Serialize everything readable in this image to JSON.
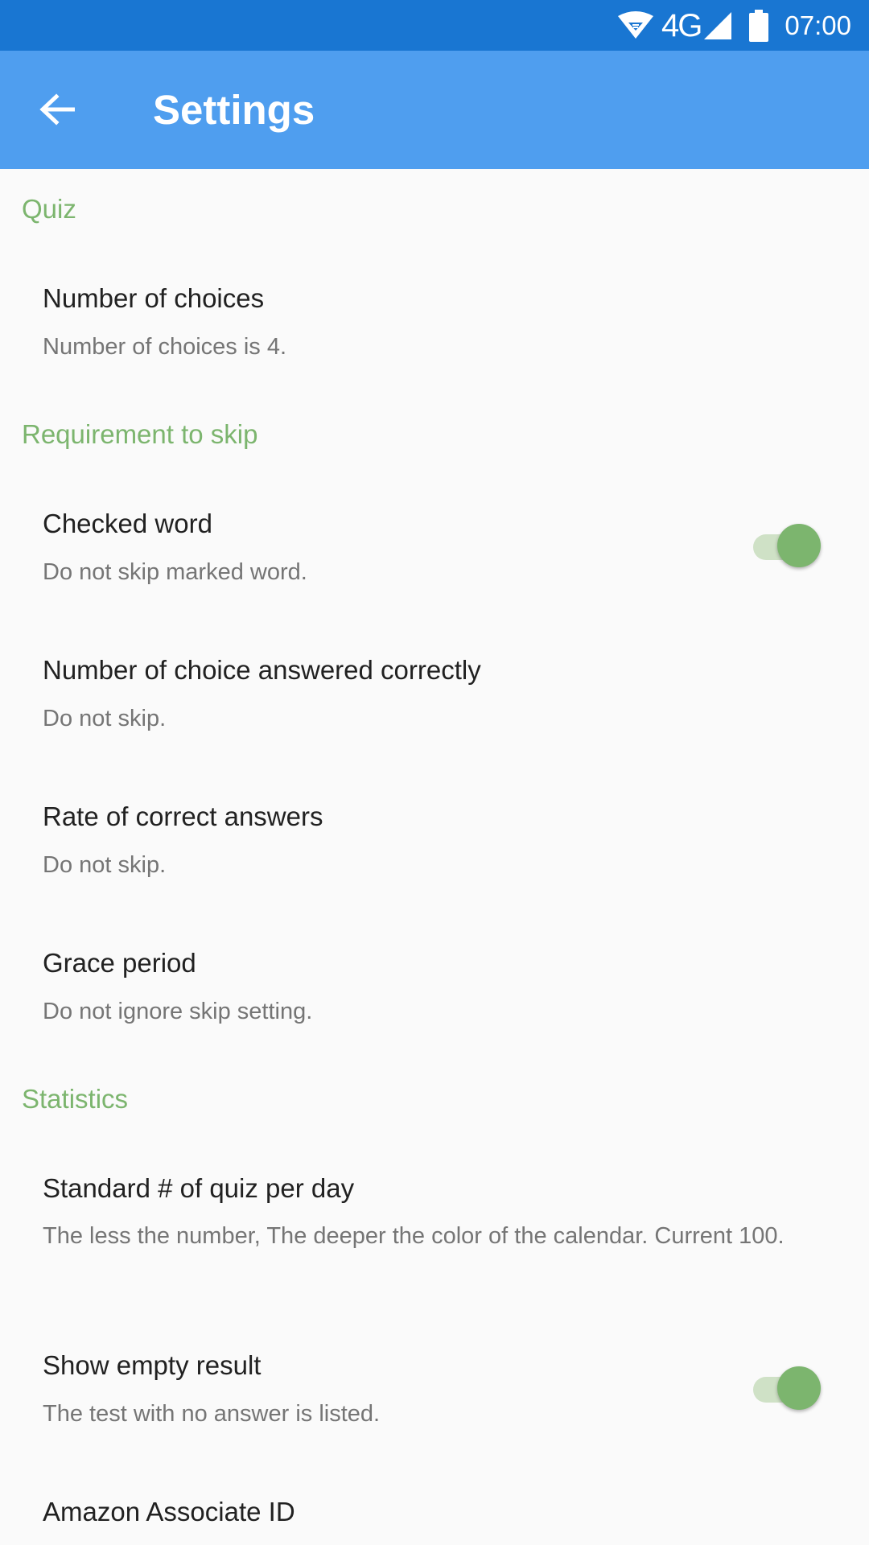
{
  "status_bar": {
    "network": "4G",
    "time": "07:00",
    "icons": [
      "wifi-icon",
      "cell-signal-icon",
      "battery-icon"
    ]
  },
  "app_bar": {
    "title": "Settings",
    "back_icon": "arrow-back-icon"
  },
  "colors": {
    "status_bar": "#1976d2",
    "app_bar": "#4f9eef",
    "accent": "#7cb56e",
    "background": "#fafafa"
  },
  "sections": {
    "quiz": {
      "header": "Quiz",
      "number_of_choices": {
        "title": "Number of choices",
        "summary": "Number of choices is 4."
      }
    },
    "skip": {
      "header": "Requirement to skip",
      "checked_word": {
        "title": "Checked word",
        "summary": "Do not skip marked word.",
        "enabled": true
      },
      "answered_correctly": {
        "title": "Number of choice answered correctly",
        "summary": "Do not skip."
      },
      "rate_correct": {
        "title": "Rate of correct answers",
        "summary": "Do not skip."
      },
      "grace_period": {
        "title": "Grace period",
        "summary": "Do not ignore skip setting."
      }
    },
    "statistics": {
      "header": "Statistics",
      "standard_quiz": {
        "title": "Standard # of quiz per day",
        "summary": "The less the number, The deeper the color of the calendar. Current 100."
      },
      "show_empty": {
        "title": "Show empty result",
        "summary": "The test with no answer is listed.",
        "enabled": true
      },
      "amazon_id": {
        "title": "Amazon Associate ID"
      }
    }
  }
}
